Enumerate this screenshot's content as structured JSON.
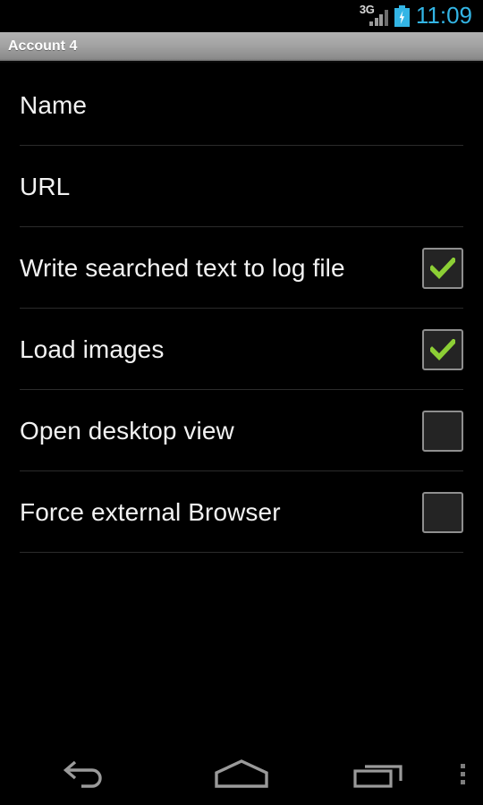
{
  "status_bar": {
    "network_type": "3G",
    "network_icon": "signal-bars-icon",
    "battery_icon": "battery-charging-icon",
    "clock": "11:09",
    "clock_color": "#33b5e5"
  },
  "title_bar": {
    "title": "Account 4"
  },
  "settings": {
    "rows": [
      {
        "label": "Name",
        "type": "text",
        "has_checkbox": false,
        "checked": false
      },
      {
        "label": "URL",
        "type": "text",
        "has_checkbox": false,
        "checked": false
      },
      {
        "label": "Write searched text to log file",
        "type": "checkbox",
        "has_checkbox": true,
        "checked": true
      },
      {
        "label": "Load images",
        "type": "checkbox",
        "has_checkbox": true,
        "checked": true
      },
      {
        "label": "Open desktop view",
        "type": "checkbox",
        "has_checkbox": true,
        "checked": false
      },
      {
        "label": "Force external Browser",
        "type": "checkbox",
        "has_checkbox": true,
        "checked": false
      }
    ],
    "checkbox_check_color": "#8ccf35",
    "checkbox_border_color": "#8f8f8f",
    "checkbox_fill_color": "#242424"
  },
  "nav_bar": {
    "back_icon": "back-arrow-icon",
    "home_icon": "home-icon",
    "recents_icon": "recent-apps-icon",
    "menu_icon": "overflow-menu-icon"
  }
}
